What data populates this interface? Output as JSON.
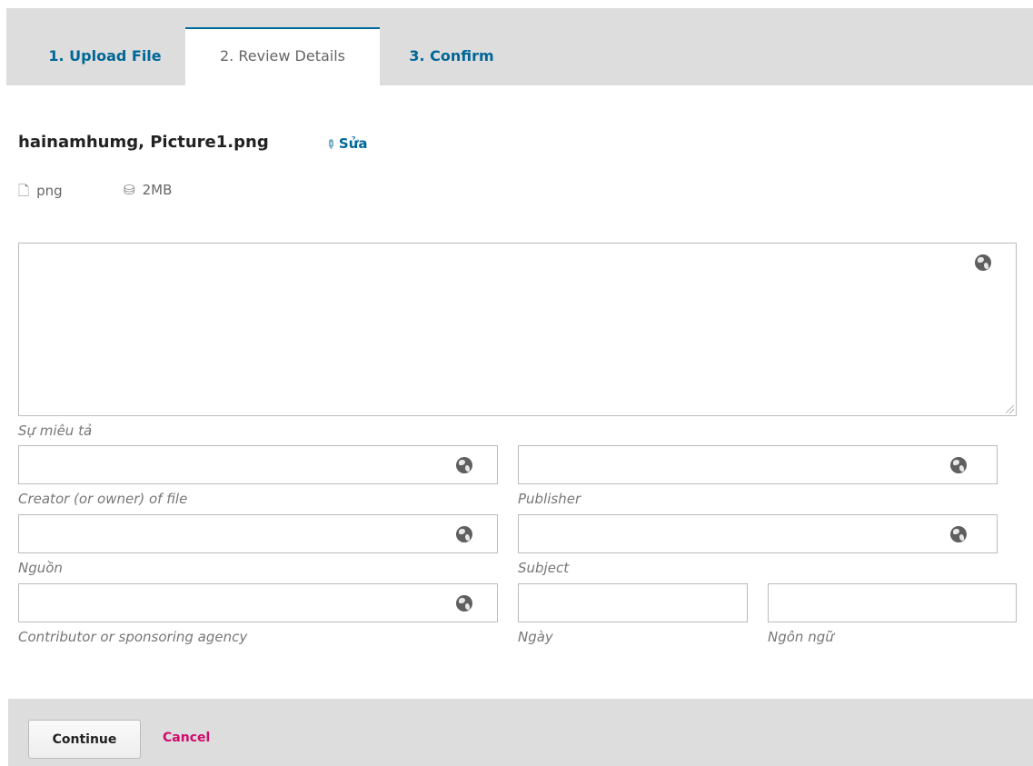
{
  "tabs": [
    {
      "label": "1. Upload File"
    },
    {
      "label": "2. Review Details"
    },
    {
      "label": "3. Confirm"
    }
  ],
  "file": {
    "title": "hainamhumg, Picture1.png",
    "edit_label": "Sửa",
    "type": "png",
    "size": "2MB"
  },
  "fields": {
    "description": {
      "label": "Sự miêu tả",
      "value": ""
    },
    "creator": {
      "label": "Creator (or owner) of file",
      "value": ""
    },
    "publisher": {
      "label": "Publisher",
      "value": ""
    },
    "source": {
      "label": "Nguồn",
      "value": ""
    },
    "subject": {
      "label": "Subject",
      "value": ""
    },
    "contributor": {
      "label": "Contributor or sponsoring agency",
      "value": ""
    },
    "date": {
      "label": "Ngày",
      "value": ""
    },
    "language": {
      "label": "Ngôn ngữ",
      "value": ""
    }
  },
  "footer": {
    "continue_label": "Continue",
    "cancel_label": "Cancel"
  },
  "colors": {
    "accent": "#006798",
    "cancel": "#d00a6c",
    "tab_bar": "#dddddd"
  },
  "icons": {
    "edit": "pencil-icon",
    "file_type": "file-icon",
    "file_size": "drive-icon",
    "multilingual": "globe-icon"
  }
}
